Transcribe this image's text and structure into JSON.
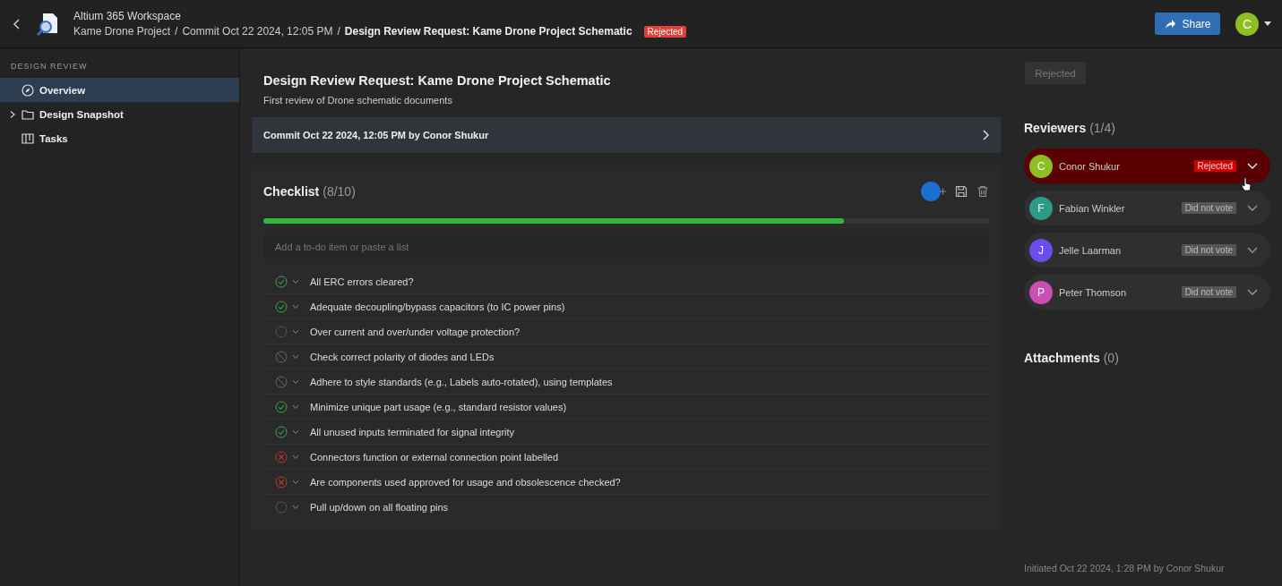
{
  "header": {
    "workspace": "Altium 365 Workspace",
    "breadcrumbs": [
      "Kame Drone Project",
      "Commit Oct 22 2024, 12:05 PM"
    ],
    "separator": "/",
    "current": "Design Review Request: Kame Drone Project Schematic",
    "status_badge": "Rejected",
    "share_button": "Share",
    "user_avatar": "C"
  },
  "sidebar": {
    "section": "DESIGN REVIEW",
    "items": [
      {
        "label": "Overview",
        "kind": "compass",
        "selected": true,
        "expandable": false
      },
      {
        "label": "Design Snapshot",
        "kind": "folder",
        "selected": false,
        "expandable": true
      },
      {
        "label": "Tasks",
        "kind": "board",
        "selected": false,
        "expandable": false
      }
    ]
  },
  "review": {
    "title": "Design Review Request: Kame Drone Project Schematic",
    "description": "First review of Drone schematic documents",
    "commit": "Commit Oct 22 2024, 12:05 PM by Conor Shukur"
  },
  "checklist": {
    "title": "Checklist",
    "count": "(8/10)",
    "level": 0.8,
    "placeholder": "Add a to-do item or paste a list",
    "items": [
      {
        "text": "All ERC errors cleared?",
        "kind": "passed"
      },
      {
        "text": "Adequate decoupling/bypass capacitors (to IC power pins)",
        "kind": "passed"
      },
      {
        "text": "Over current and over/under voltage protection?",
        "kind": "open"
      },
      {
        "text": "Check correct polarity of diodes and LEDs",
        "kind": "skipped"
      },
      {
        "text": "Adhere to style standards (e.g., Labels auto-rotated), using templates",
        "kind": "skipped"
      },
      {
        "text": "Minimize unique part usage (e.g., standard resistor values)",
        "kind": "passed"
      },
      {
        "text": "All unused inputs terminated for signal integrity",
        "kind": "passed"
      },
      {
        "text": "Connectors function or external connection point labelled",
        "kind": "failed"
      },
      {
        "text": "Are components used approved for usage and obsolescence checked?",
        "kind": "failed"
      },
      {
        "text": "Pull up/down on all floating pins",
        "kind": "open"
      }
    ]
  },
  "side_panel": {
    "status_button": "Rejected",
    "reviewers_title": "Reviewers",
    "reviewers_count": "(1/4)",
    "reviewers": [
      {
        "initial": "C",
        "name": "Conor Shukur",
        "color": "#8cbf1f",
        "vote": "Rejected",
        "kind": "rejected"
      },
      {
        "initial": "F",
        "name": "Fabian Winkler",
        "color": "#2e9a8a",
        "vote": "Did not vote",
        "kind": "none"
      },
      {
        "initial": "J",
        "name": "Jelle Laarman",
        "color": "#6b4cf0",
        "vote": "Did not vote",
        "kind": "none"
      },
      {
        "initial": "P",
        "name": "Peter Thomson",
        "color": "#c94fb5",
        "vote": "Did not vote",
        "kind": "none"
      }
    ],
    "attachments_title": "Attachments",
    "attachments_count": "(0)",
    "footer": "Initiated Oct 22 2024, 1:28 PM by Conor Shukur"
  }
}
